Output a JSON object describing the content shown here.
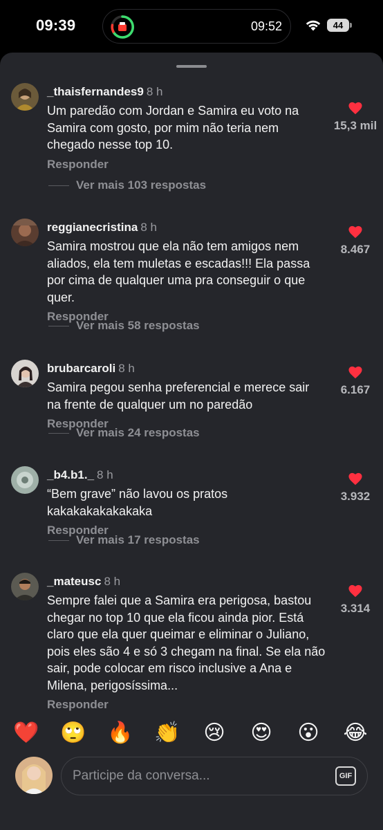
{
  "status_bar": {
    "time": "09:39",
    "island_time": "09:52",
    "battery_level": "44"
  },
  "comments": [
    {
      "username": "_thaisfernandes9",
      "time": "8 h",
      "text": "Um paredão com Jordan e Samira eu voto na Samira com gosto, por mim não teria nem chegado nesse top 10.",
      "reply_label": "Responder",
      "more_replies": "Ver mais 103 respostas",
      "likes": "15,3 mil"
    },
    {
      "username": "reggianecristina",
      "time": "8 h",
      "text": "Samira mostrou que ela não tem amigos nem aliados, ela tem muletas e escadas!!! Ela passa por cima de qualquer uma pra conseguir o que quer.",
      "reply_label": "Responder",
      "more_replies": "Ver mais 58 respostas",
      "likes": "8.467"
    },
    {
      "username": "brubarcaroli",
      "time": "8 h",
      "text": "Samira pegou senha preferencial e merece sair na frente de qualquer um no paredão",
      "reply_label": "Responder",
      "more_replies": "Ver mais 24 respostas",
      "likes": "6.167"
    },
    {
      "username": "_b4.b1._",
      "time": "8 h",
      "text": "“Bem grave” não lavou os pratos kakakakakakakaka",
      "reply_label": "Responder",
      "more_replies": "Ver mais 17 respostas",
      "likes": "3.932"
    },
    {
      "username": "_mateusc",
      "time": "8 h",
      "text": "Sempre falei que a Samira era perigosa, bastou chegar no top 10 que ela ficou ainda pior. Está claro que ela quer queimar e eliminar o Juliano, pois eles são 4 e só 3 chegam na final. Se ela não sair, pode colocar em risco inclusive a Ana e Milena, perigosíssima...",
      "reply_label": "Responder",
      "likes": "3.314"
    }
  ],
  "quick_reactions": [
    "❤️",
    "🙄",
    "🔥",
    "👏",
    "😢",
    "😍",
    "😮",
    "😂"
  ],
  "composer": {
    "placeholder": "Participe da conversa...",
    "gif_label": "GIF"
  },
  "colors": {
    "sheet_bg": "#25262b",
    "heart": "#ff3040",
    "muted_text": "#8e8f94"
  }
}
